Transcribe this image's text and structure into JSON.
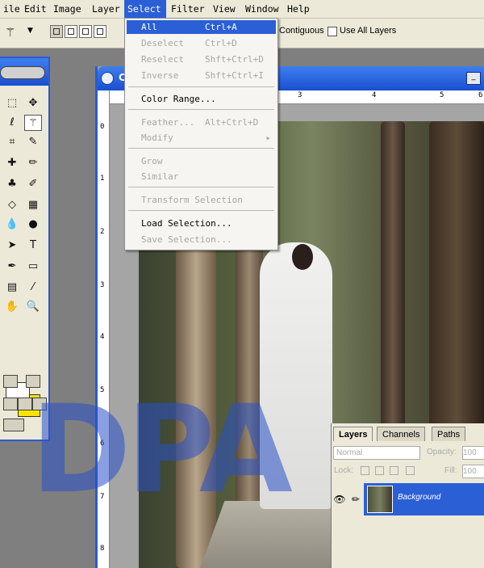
{
  "menubar": {
    "items": [
      "ile",
      "Edit",
      "Image",
      "Layer",
      "Select",
      "Filter",
      "View",
      "Window",
      "Help"
    ],
    "active_index": 4
  },
  "options": {
    "contiguous_label": "Contiguous",
    "use_all_layers_label": "Use All Layers",
    "contiguous_checked": true,
    "use_all_layers_checked": false
  },
  "select_menu": {
    "items": [
      {
        "label": "All",
        "shortcut": "Ctrl+A",
        "enabled": true,
        "highlighted": true
      },
      {
        "label": "Deselect",
        "shortcut": "Ctrl+D",
        "enabled": false
      },
      {
        "label": "Reselect",
        "shortcut": "Shft+Ctrl+D",
        "enabled": false
      },
      {
        "label": "Inverse",
        "shortcut": "Shft+Ctrl+I",
        "enabled": false
      },
      {
        "label": "Color Range...",
        "shortcut": "",
        "enabled": true
      },
      {
        "label": "Feather...",
        "shortcut": "Alt+Ctrl+D",
        "enabled": false
      },
      {
        "label": "Modify",
        "shortcut": "",
        "enabled": false,
        "submenu": true
      },
      {
        "label": "Grow",
        "shortcut": "",
        "enabled": false
      },
      {
        "label": "Similar",
        "shortcut": "",
        "enabled": false
      },
      {
        "label": "Transform Selection",
        "shortcut": "",
        "enabled": false
      },
      {
        "label": "Load Selection...",
        "shortcut": "",
        "enabled": true
      },
      {
        "label": "Save Selection...",
        "shortcut": "",
        "enabled": false
      }
    ]
  },
  "document": {
    "title_fragment": "C",
    "ruler_top": [
      "3",
      "4",
      "5",
      "6"
    ],
    "ruler_left": [
      "0",
      "1",
      "2",
      "3",
      "4",
      "5",
      "6",
      "7",
      "8"
    ]
  },
  "colors": {
    "foreground": "#ffffff",
    "background": "#ffe400",
    "accent": "#2b5fd6"
  },
  "watermark": "DPA",
  "layers_panel": {
    "tabs": [
      "Layers",
      "Channels",
      "Paths"
    ],
    "active_tab": "Layers",
    "blend_mode": "Normal",
    "opacity_label": "Opacity:",
    "opacity_value": "100",
    "lock_label": "Lock:",
    "fill_label": "Fill:",
    "fill_value": "100",
    "layer_name": "Background"
  }
}
